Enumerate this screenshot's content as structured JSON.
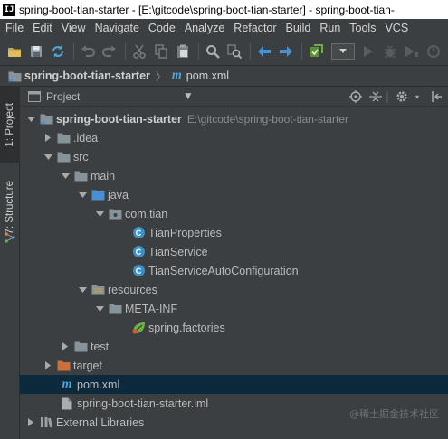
{
  "window": {
    "app_icon": "IJ",
    "title": "spring-boot-tian-starter - [E:\\gitcode\\spring-boot-tian-starter] - spring-boot-tian-"
  },
  "menu": [
    "File",
    "Edit",
    "View",
    "Navigate",
    "Code",
    "Analyze",
    "Refactor",
    "Build",
    "Run",
    "Tools",
    "VCS"
  ],
  "toolbar": {
    "icons": [
      "open-folder-icon",
      "save-icon",
      "sync-icon",
      "undo-icon",
      "redo-icon",
      "cut-icon",
      "copy-icon",
      "paste-icon",
      "find-icon",
      "replace-icon",
      "back-icon",
      "forward-icon",
      "build-icon",
      "run-config-dropdown",
      "run-icon",
      "debug-icon"
    ]
  },
  "breadcrumb": {
    "project": "spring-boot-tian-starter",
    "file": "pom.xml"
  },
  "side_tabs": {
    "project": "1: Project",
    "structure": "7: Structure"
  },
  "panel": {
    "title": "Project"
  },
  "tree": {
    "root_label": "spring-boot-tian-starter",
    "root_path": "E:\\gitcode\\spring-boot-tian-starter",
    "idea": ".idea",
    "src": "src",
    "main": "main",
    "java": "java",
    "package": "com.tian",
    "class1": "TianProperties",
    "class2": "TianService",
    "class3": "TianServiceAutoConfiguration",
    "resources": "resources",
    "meta_inf": "META-INF",
    "factories": "spring.factories",
    "test": "test",
    "target": "target",
    "pom": "pom.xml",
    "iml": "spring-boot-tian-starter.iml",
    "libs": "External Libraries"
  },
  "watermark": "@稀土掘金技术社区",
  "colors": {
    "background": "#3c3f41",
    "selection": "#0d293e",
    "folder": "#87939a",
    "source_folder": "#4a8fd1",
    "target_folder": "#c9703b",
    "class_icon": "#3a8fc4"
  }
}
